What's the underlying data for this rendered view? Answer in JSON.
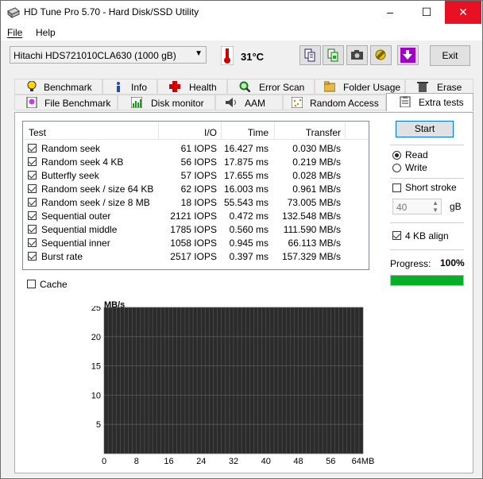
{
  "window": {
    "title": "HD Tune Pro 5.70 - Hard Disk/SSD Utility",
    "minimize": "–",
    "maximize": "☐",
    "close": "✕"
  },
  "menu": {
    "file": "File",
    "help": "Help"
  },
  "toolbar": {
    "drive": "Hitachi HDS721010CLA630 (1000 gB)",
    "temperature": "31°C",
    "exit": "Exit"
  },
  "tabs_top": [
    "Benchmark",
    "Info",
    "Health",
    "Error Scan",
    "Folder Usage",
    "Erase"
  ],
  "tabs_bottom": [
    "File Benchmark",
    "Disk monitor",
    "AAM",
    "Random Access",
    "Extra tests"
  ],
  "active_tab": "Extra tests",
  "table": {
    "headers": {
      "test": "Test",
      "io": "I/O",
      "time": "Time",
      "transfer": "Transfer"
    },
    "rows": [
      {
        "test": "Random seek",
        "io": "61 IOPS",
        "time": "16.427 ms",
        "transfer": "0.030 MB/s",
        "checked": true
      },
      {
        "test": "Random seek 4 KB",
        "io": "56 IOPS",
        "time": "17.875 ms",
        "transfer": "0.219 MB/s",
        "checked": true
      },
      {
        "test": "Butterfly seek",
        "io": "57 IOPS",
        "time": "17.655 ms",
        "transfer": "0.028 MB/s",
        "checked": true
      },
      {
        "test": "Random seek / size 64 KB",
        "io": "62 IOPS",
        "time": "16.003 ms",
        "transfer": "0.961 MB/s",
        "checked": true
      },
      {
        "test": "Random seek / size 8 MB",
        "io": "18 IOPS",
        "time": "55.543 ms",
        "transfer": "73.005 MB/s",
        "checked": true
      },
      {
        "test": "Sequential outer",
        "io": "2121 IOPS",
        "time": "0.472 ms",
        "transfer": "132.548 MB/s",
        "checked": true
      },
      {
        "test": "Sequential middle",
        "io": "1785 IOPS",
        "time": "0.560 ms",
        "transfer": "111.590 MB/s",
        "checked": true
      },
      {
        "test": "Sequential inner",
        "io": "1058 IOPS",
        "time": "0.945 ms",
        "transfer": "66.113 MB/s",
        "checked": true
      },
      {
        "test": "Burst rate",
        "io": "2517 IOPS",
        "time": "0.397 ms",
        "transfer": "157.329 MB/s",
        "checked": true
      }
    ]
  },
  "controls": {
    "start": "Start",
    "read": "Read",
    "write": "Write",
    "short_stroke": "Short stroke",
    "stroke_value": "40",
    "stroke_unit": "gB",
    "align": "4 KB align",
    "progress_label": "Progress:",
    "progress_value": "100%",
    "progress_fraction": 1.0,
    "cache": "Cache"
  },
  "chart_data": {
    "type": "line",
    "title": "",
    "ylabel": "MB/s",
    "xlabel": "",
    "yticks": [
      "25",
      "20",
      "15",
      "10",
      "5"
    ],
    "xticks": [
      "0",
      "8",
      "16",
      "24",
      "32",
      "40",
      "48",
      "56",
      "64MB"
    ],
    "ylim": [
      0,
      25
    ],
    "xlim": [
      0,
      64
    ],
    "series": []
  },
  "colors": {
    "close_button": "#e81123",
    "progress": "#06b025",
    "chart_bg": "#2b2b2b",
    "grid": "#5a5a5a"
  }
}
